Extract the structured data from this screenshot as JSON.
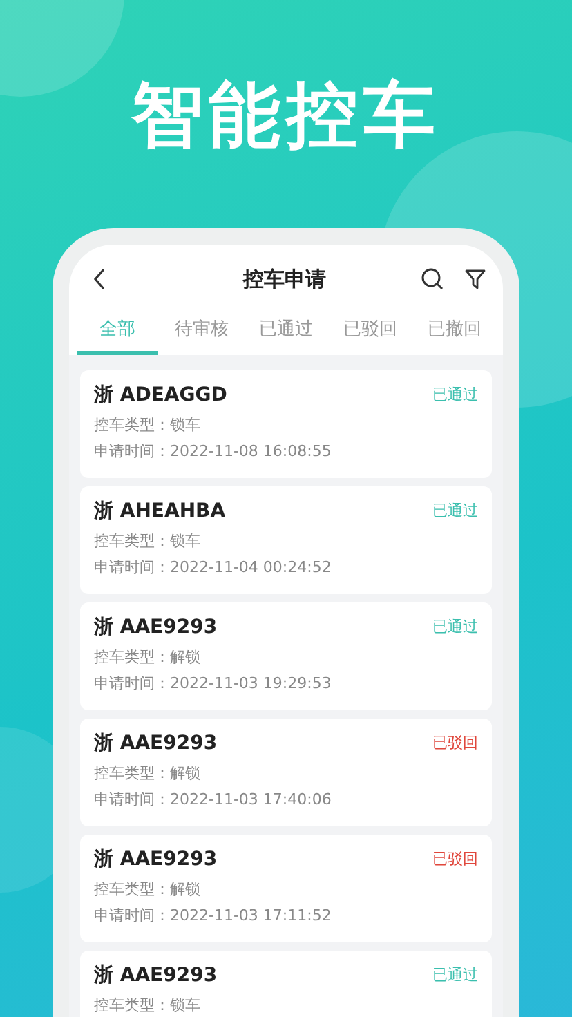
{
  "headline": "智能控车",
  "app_bar": {
    "title": "控车申请"
  },
  "tabs": [
    {
      "label": "全部",
      "selected": true
    },
    {
      "label": "待审核",
      "selected": false
    },
    {
      "label": "已通过",
      "selected": false
    },
    {
      "label": "已驳回",
      "selected": false
    },
    {
      "label": "已撤回",
      "selected": false
    }
  ],
  "requests": [
    {
      "plate": "浙 ADEAGGD",
      "status": "已通过",
      "kind": "approved",
      "type_label": "控车类型：",
      "type": "锁车",
      "time_label": "申请时间：",
      "time": "2022-11-08 16:08:55"
    },
    {
      "plate": "浙 AHEAHBA",
      "status": "已通过",
      "kind": "approved",
      "type_label": "控车类型：",
      "type": "锁车",
      "time_label": "申请时间：",
      "time": "2022-11-04 00:24:52"
    },
    {
      "plate": "浙 AAE9293",
      "status": "已通过",
      "kind": "approved",
      "type_label": "控车类型：",
      "type": "解锁",
      "time_label": "申请时间：",
      "time": "2022-11-03 19:29:53"
    },
    {
      "plate": "浙 AAE9293",
      "status": "已驳回",
      "kind": "rejected",
      "type_label": "控车类型：",
      "type": "解锁",
      "time_label": "申请时间：",
      "time": "2022-11-03 17:40:06"
    },
    {
      "plate": "浙 AAE9293",
      "status": "已驳回",
      "kind": "rejected",
      "type_label": "控车类型：",
      "type": "解锁",
      "time_label": "申请时间：",
      "time": "2022-11-03 17:11:52"
    },
    {
      "plate": "浙 AAE9293",
      "status": "已通过",
      "kind": "approved",
      "type_label": "控车类型：",
      "type": "锁车"
    }
  ]
}
